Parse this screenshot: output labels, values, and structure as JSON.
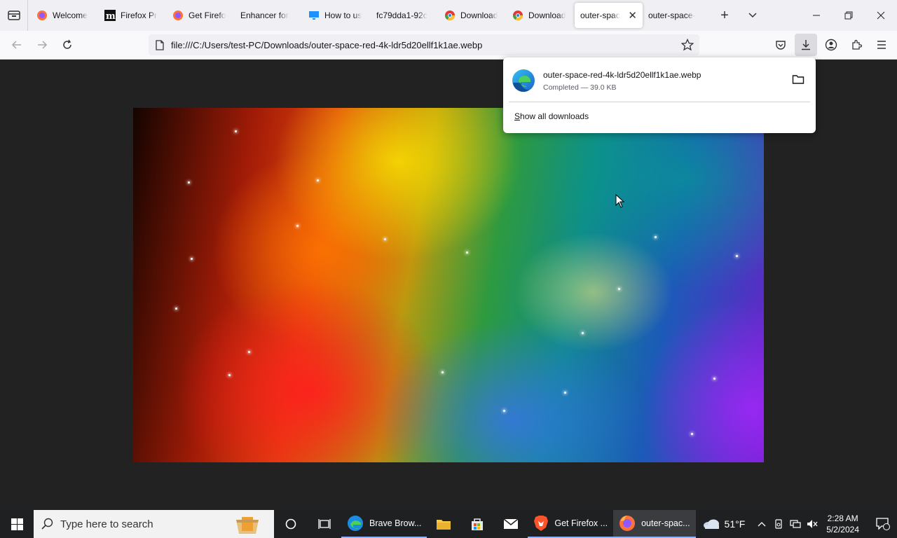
{
  "tabs": [
    {
      "title": "Welcome",
      "icon": "firefox-icon",
      "active": false
    },
    {
      "title": "Firefox Pr",
      "icon": "medium-icon",
      "active": false
    },
    {
      "title": "Get Firefo",
      "icon": "firefox-icon",
      "active": false
    },
    {
      "title": "Enhancer for",
      "icon": "none",
      "active": false
    },
    {
      "title": "How to us",
      "icon": "monitor-icon",
      "active": false
    },
    {
      "title": "fc79dda1-92c",
      "icon": "none",
      "active": false
    },
    {
      "title": "Download",
      "icon": "chrome-icon",
      "active": false
    },
    {
      "title": "Download",
      "icon": "chrome-icon",
      "active": false
    },
    {
      "title": "outer-spac",
      "icon": "none",
      "active": true
    },
    {
      "title": "outer-space-",
      "icon": "none",
      "active": false
    }
  ],
  "navbar": {
    "url": "file:///C:/Users/test-PC/Downloads/outer-space-red-4k-ldr5d20ellf1k1ae.webp"
  },
  "downloads": {
    "filename": "outer-space-red-4k-ldr5d20ellf1k1ae.webp",
    "status": "Completed — 39.0 KB",
    "show_all_prefix": "S",
    "show_all_rest": "how all downloads"
  },
  "taskbar": {
    "search_placeholder": "Type here to search",
    "apps": [
      {
        "label": "Brave Brow...",
        "icon": "edge-icon"
      },
      {
        "label": "Get Firefox ...",
        "icon": "brave-icon"
      },
      {
        "label": "outer-spac...",
        "icon": "firefox-icon"
      }
    ],
    "weather": "51°F",
    "time": "2:28 AM",
    "date": "5/2/2024",
    "notification_count": "1"
  },
  "colors": {
    "tabstrip_bg": "#f0f0f4",
    "taskbar_bg": "#1f2022",
    "content_bg": "#222222",
    "accent": "#0060df"
  }
}
